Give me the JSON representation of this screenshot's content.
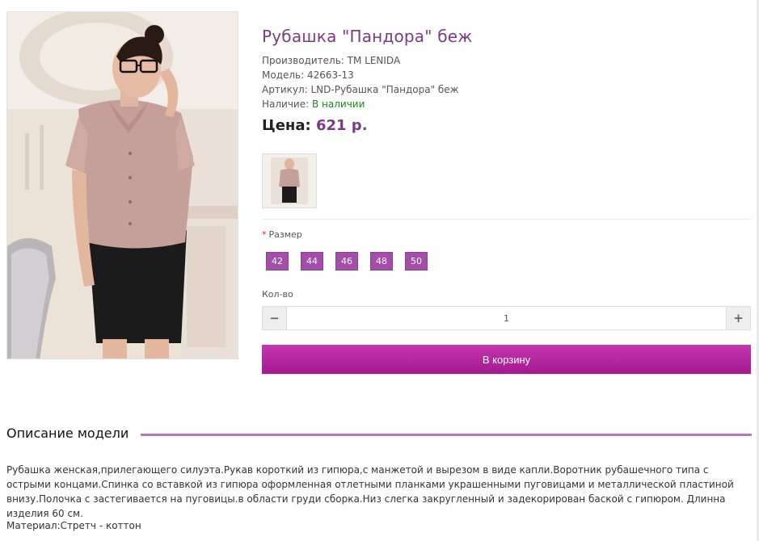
{
  "product": {
    "title": "Рубашка \"Пандора\" беж",
    "manufacturer": "Производитель: ТМ LENIDA",
    "model": "Модель: 42663-13",
    "sku": "Артикул: LND-Рубашка \"Пандора\" беж",
    "availability_label": "Наличие: ",
    "availability_value": "В наличии",
    "price_label": "Цена: ",
    "price_value": "621 р."
  },
  "options": {
    "size_required_mark": "*",
    "size_label": "Размер",
    "sizes": [
      "42",
      "44",
      "46",
      "48",
      "50"
    ],
    "qty_label": "Кол-во",
    "qty_minus": "−",
    "qty_plus": "+",
    "qty_value": "1"
  },
  "cart": {
    "button_label": "В корзину"
  },
  "description": {
    "title": "Описание модели",
    "text": "Рубашка женская,прилегающего силуэта.Рукав короткий из гипюра,с манжетой и вырезом в виде капли.Воротник рубашечного типа с острыми концами.Спинка со вставкой из гипюра оформленная отлетными планками украшенными пуговицами и металлической пластиной внизу.Полочка с застегивается на пуговицы.в области груди сборка.Низ слегка закругленный и задекорирован баской с гипюром. Длинна изделия 60 см.",
    "material": "Материал:Стретч - коттон"
  },
  "colors": {
    "title": "#7b3b83",
    "size_button": "#a14fa8",
    "cart_button": "#b12a9e",
    "in_stock": "#1a8a1a",
    "divider_accent": "#b27ab7"
  }
}
